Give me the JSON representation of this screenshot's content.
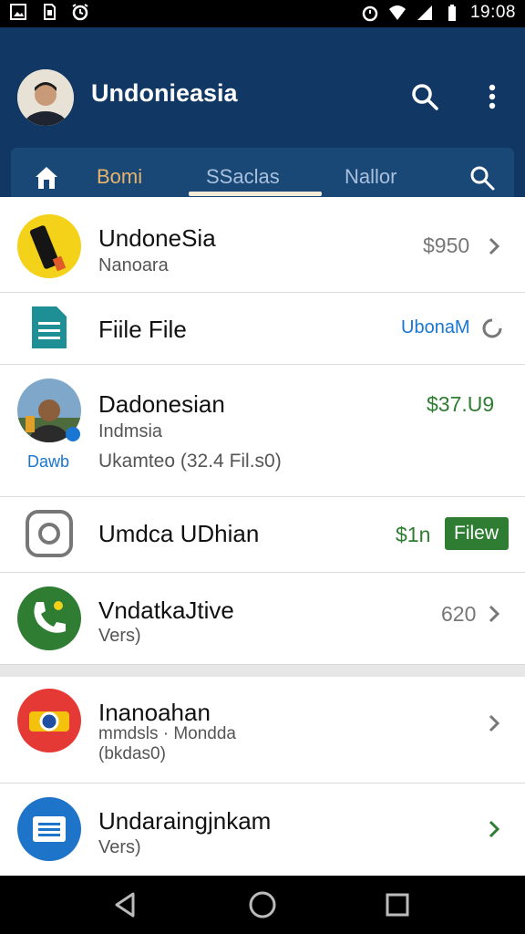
{
  "status_bar": {
    "time": "19:08",
    "left_icons": [
      "gallery-icon",
      "sim-card-icon",
      "alarm-icon"
    ],
    "right_icons": [
      "alarm-icon",
      "wifi-icon",
      "signal-icon",
      "battery-icon"
    ]
  },
  "app_bar": {
    "title": "Undonieasia",
    "background": "#113864",
    "icons": [
      "search-icon",
      "more-vert-icon"
    ]
  },
  "tabs": {
    "items": [
      {
        "label": "Bomi"
      },
      {
        "label": "SSaclas"
      },
      {
        "label": "Nallor"
      }
    ],
    "active_index": 0,
    "icons": [
      "home-icon",
      "search-icon"
    ]
  },
  "list": [
    {
      "title": "UndoneSia",
      "subtitle": "Nanoara",
      "right_text": "$950",
      "icon": "yellow-app-icon"
    },
    {
      "title": "Fiile File",
      "right_text": "UbonaM",
      "icon": "document-icon"
    },
    {
      "title": "Dadonesian",
      "subtitle": "Indmsia",
      "detail": "Ukamteo (32.4 Fil.s0)",
      "right_text": "$37.U9",
      "avatar_caption": "Dawb",
      "icon": "photo-avatar"
    },
    {
      "title": "Umdca UDhian",
      "right_text": "$1n",
      "button_label": "Filew",
      "icon": "rounded-square-icon"
    },
    {
      "title": "VndatkaJtive",
      "subtitle": "Vers)",
      "right_text": "620",
      "icon": "phone-icon"
    },
    {
      "title": "Inanoahan",
      "subtitle": "mmdsls · Mondda",
      "detail": "(bkdas0)",
      "icon": "chrome-icon"
    },
    {
      "title": "Undaraingjnkam",
      "subtitle": "Vers)",
      "icon": "message-icon"
    }
  ],
  "colors": {
    "accent_green": "#2e7d32",
    "tab_active": "#e6b46b",
    "tab_inactive": "#a9c0dd",
    "link_blue": "#1976d2"
  },
  "nav_bar": {
    "buttons": [
      "back-icon",
      "home-circle-icon",
      "recents-icon"
    ]
  }
}
